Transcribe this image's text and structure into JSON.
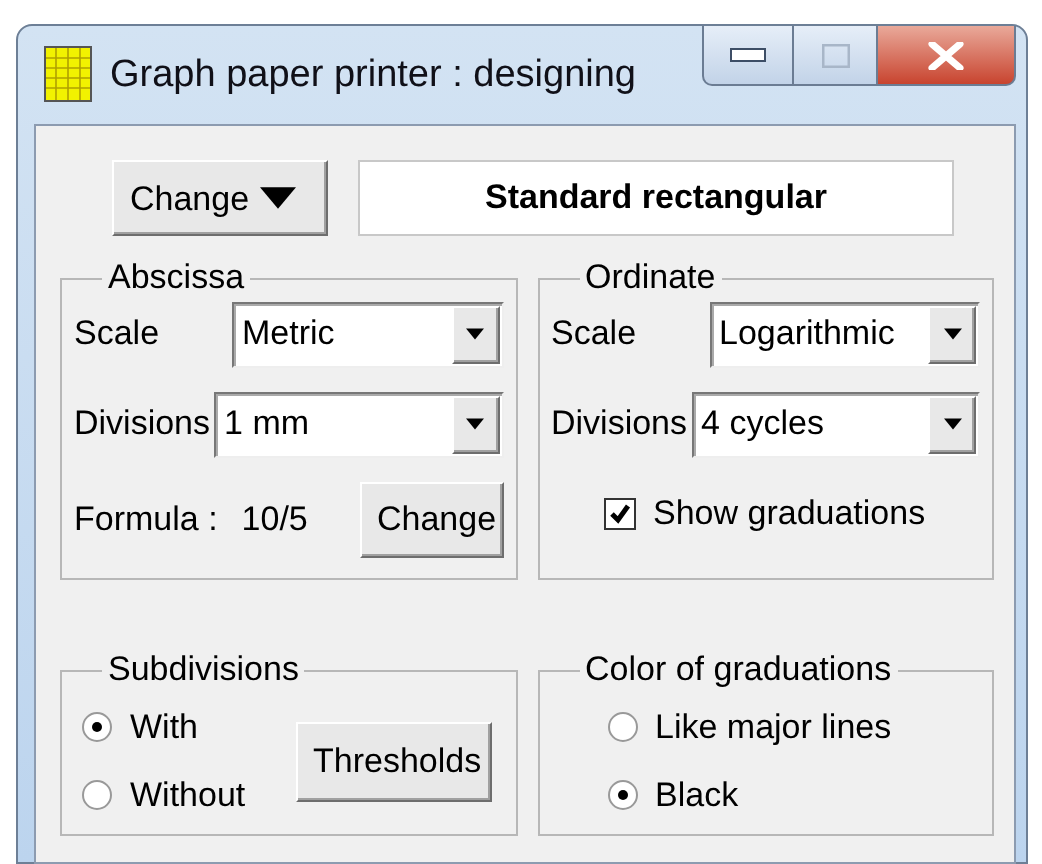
{
  "window": {
    "title": "Graph paper printer : designing"
  },
  "change_button": {
    "label": "Change"
  },
  "template": {
    "value": "Standard rectangular"
  },
  "abscissa": {
    "title": "Abscissa",
    "scale": {
      "label": "Scale",
      "value": "Metric"
    },
    "divisions": {
      "label": "Divisions",
      "value": "1 mm"
    },
    "formula_label": "Formula :",
    "formula_value": "10/5",
    "change_button": "Change"
  },
  "ordinate": {
    "title": "Ordinate",
    "scale": {
      "label": "Scale",
      "value": "Logarithmic"
    },
    "divisions": {
      "label": "Divisions",
      "value": "4 cycles"
    },
    "show_graduations": {
      "label": "Show graduations",
      "checked": true
    }
  },
  "subdivisions": {
    "title": "Subdivisions",
    "options": [
      {
        "label": "With",
        "selected": true
      },
      {
        "label": "Without",
        "selected": false
      }
    ],
    "thresholds_button": "Thresholds"
  },
  "color_of_graduations": {
    "title": "Color of graduations",
    "options": [
      {
        "label": "Like major lines",
        "selected": false
      },
      {
        "label": "Black",
        "selected": true
      }
    ]
  }
}
